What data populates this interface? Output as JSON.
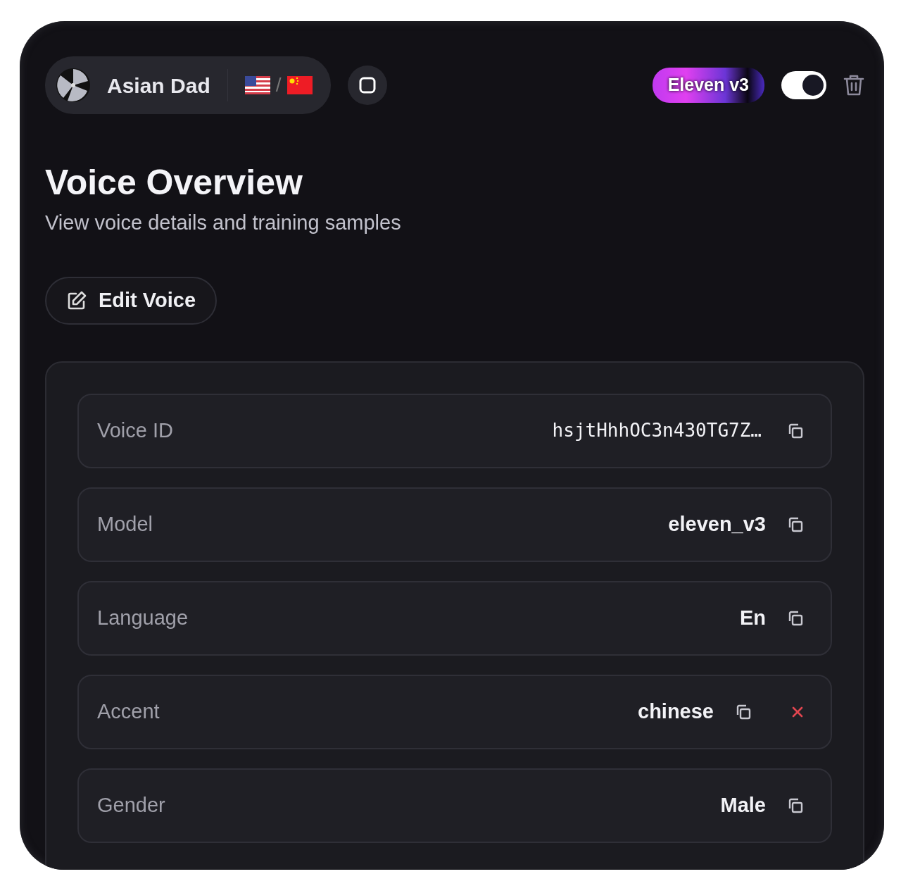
{
  "voice": {
    "name": "Asian Dad",
    "flag_separator": "/"
  },
  "model_badge": "Eleven v3",
  "enabled_toggle": {
    "on": true
  },
  "page": {
    "title": "Voice Overview",
    "subtitle": "View voice details and training samples"
  },
  "edit_button": "Edit Voice",
  "fields": [
    {
      "label": "Voice ID",
      "value": "hsjtHhhOC3n430TG7Z…",
      "kind": "mono",
      "removable": false
    },
    {
      "label": "Model",
      "value": "eleven_v3",
      "kind": "text",
      "removable": false
    },
    {
      "label": "Language",
      "value": "En",
      "kind": "text",
      "removable": false
    },
    {
      "label": "Accent",
      "value": "chinese",
      "kind": "text",
      "removable": true
    },
    {
      "label": "Gender",
      "value": "Male",
      "kind": "text",
      "removable": false
    }
  ]
}
